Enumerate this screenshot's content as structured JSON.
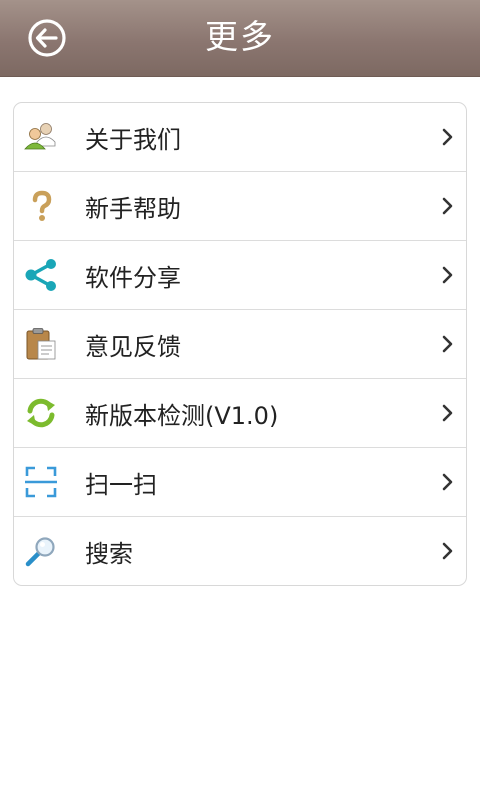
{
  "header": {
    "title": "更多",
    "back_icon": "back-arrow-circle-icon"
  },
  "menu": {
    "items": [
      {
        "label": "关于我们",
        "icon": "users-icon"
      },
      {
        "label": "新手帮助",
        "icon": "question-icon"
      },
      {
        "label": "软件分享",
        "icon": "share-icon"
      },
      {
        "label": "意见反馈",
        "icon": "clipboard-icon"
      },
      {
        "label": "新版本检测(V1.0)",
        "icon": "refresh-icon"
      },
      {
        "label": "扫一扫",
        "icon": "scan-icon"
      },
      {
        "label": "搜索",
        "icon": "search-icon"
      }
    ]
  },
  "colors": {
    "header_top": "#a4928a",
    "header_bottom": "#7d6962",
    "share_teal": "#1aa6b7",
    "refresh_green": "#7cbb2e",
    "scan_blue": "#3a9ad9",
    "question_tan": "#c9a05a"
  }
}
